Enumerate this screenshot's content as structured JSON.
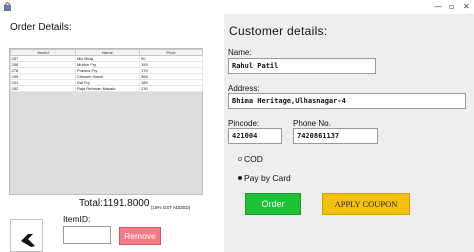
{
  "window": {
    "minimize_glyph": "—",
    "maximize_glyph": "▫",
    "close_glyph": "✕"
  },
  "order": {
    "title": "Order Details:",
    "columns": [
      "ItemId",
      "Name",
      "Price"
    ],
    "rows": [
      [
        "257",
        "Mix Bhaji",
        "90"
      ],
      [
        "258",
        "Mutton Fry",
        "159"
      ],
      [
        "278",
        "Prawns Fry",
        "179"
      ],
      [
        "239",
        "Chicken Handi",
        "365"
      ],
      [
        "241",
        "Dal Fry",
        "189"
      ],
      [
        "252",
        "Raja Rehman Masala",
        "230"
      ]
    ],
    "total": "Total:1191.8000",
    "gst_note": "(18% GST ADDED)",
    "itemid_label": "ItemID:",
    "itemid_value": "",
    "remove_label": "Remove"
  },
  "customer": {
    "title": "Customer details:",
    "name_label": "Name:",
    "name_value": "Rahul Patil",
    "address_label": "Address:",
    "address_value": "Bhima Heritage,Ulhasnagar-4",
    "pincode_label": "Pincode:",
    "pincode_value": "421004",
    "phone_label": "Phone No.",
    "phone_value": "7420861137",
    "payment_options": [
      {
        "label": "COD",
        "selected": false
      },
      {
        "label": "Pay by Card",
        "selected": true
      }
    ],
    "order_label": "Order",
    "coupon_label": "APPLY COUPON"
  },
  "colors": {
    "remove_button": "#f07b85",
    "order_button": "#1ec235",
    "coupon_button": "#f4c20d",
    "right_panel": "#eeeeee"
  },
  "icons": {
    "app": "app-icon",
    "back": "back-arrow-icon"
  }
}
